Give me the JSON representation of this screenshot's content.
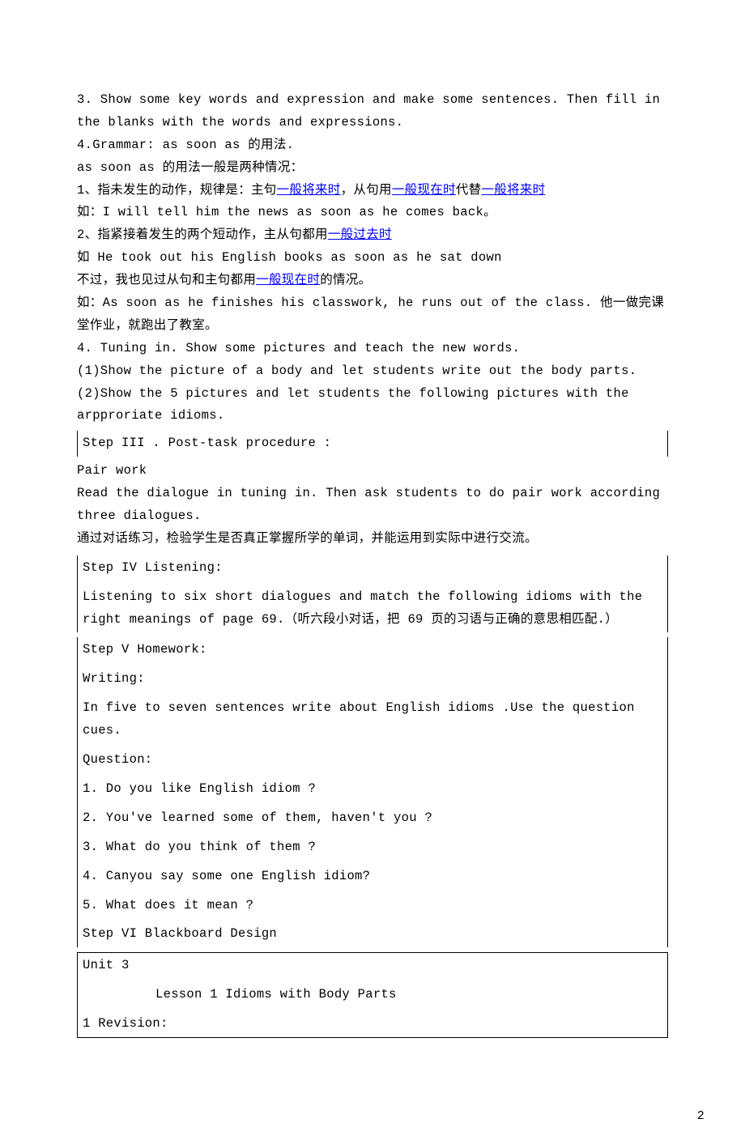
{
  "p3": "3. Show some key words and expression and make some sentences. Then fill in the blanks with the words and expressions.",
  "p4": "4.Grammar: as soon as 的用法.",
  "p5": "as soon as 的用法一般是两种情况：",
  "p6a": "1、指未发生的动作，规律是：主句",
  "p6b": "一般将来时",
  "p6c": "，从句用",
  "p6d": "一般现在时",
  "p6e": "代替",
  "p6f": "一般将来时",
  "p7": "如：I will tell him the news as soon as he comes back。",
  "p8a": "2、指紧接着发生的两个短动作，主从句都用",
  "p8b": "一般过去时",
  "p9": "如 He took out his English books as soon as he sat down",
  "p10a": "不过，我也见过从句和主句都用",
  "p10b": "一般现在时",
  "p10c": "的情况。",
  "p11": "如：As soon as he finishes his classwork, he runs out of the class. 他一做完课堂作业，就跑出了教室。",
  "p12": "4. Tuning in. Show some pictures and teach the new words.",
  "p13": " (1)Show the picture of a body and let students write out the body parts.",
  "p14": "(2)Show the 5 pictures and let students the following pictures with the arpproriate idioms.",
  "step3": "Step III .  Post-task  procedure  :",
  "p15": "  Pair work",
  "p16": " Read the dialogue in tuning in. Then ask students to do pair work according three dialogues.",
  "p17": "通过对话练习，检验学生是否真正掌握所学的单词，并能运用到实际中进行交流。",
  "step4": "Step IV Listening:",
  "p18": " Listening to six short dialogues and match the following idioms with the right meanings of page 69.（听六段小对话，把 69 页的习语与正确的意思相匹配.）",
  "step5": "Step V Homework:",
  "p19": "Writing:",
  "p20": "  In five to seven sentences write about English idioms .Use the question cues.",
  "p21": "Question:",
  "q1": "1. Do you like English idiom ?",
  "q2": "2. You've learned some of them, haven't you ?",
  "q3": "3. What do you think of them ?",
  "q4": "4. Canyou say some one English idiom?",
  "q5": "5. What does it mean ?",
  "step6": "Step VI Blackboard Design",
  "bbox1": "Unit 3",
  "bbox2": "Lesson 1  Idioms with Body Parts",
  "bbox3": "1 Revision:",
  "pageNum": "2"
}
